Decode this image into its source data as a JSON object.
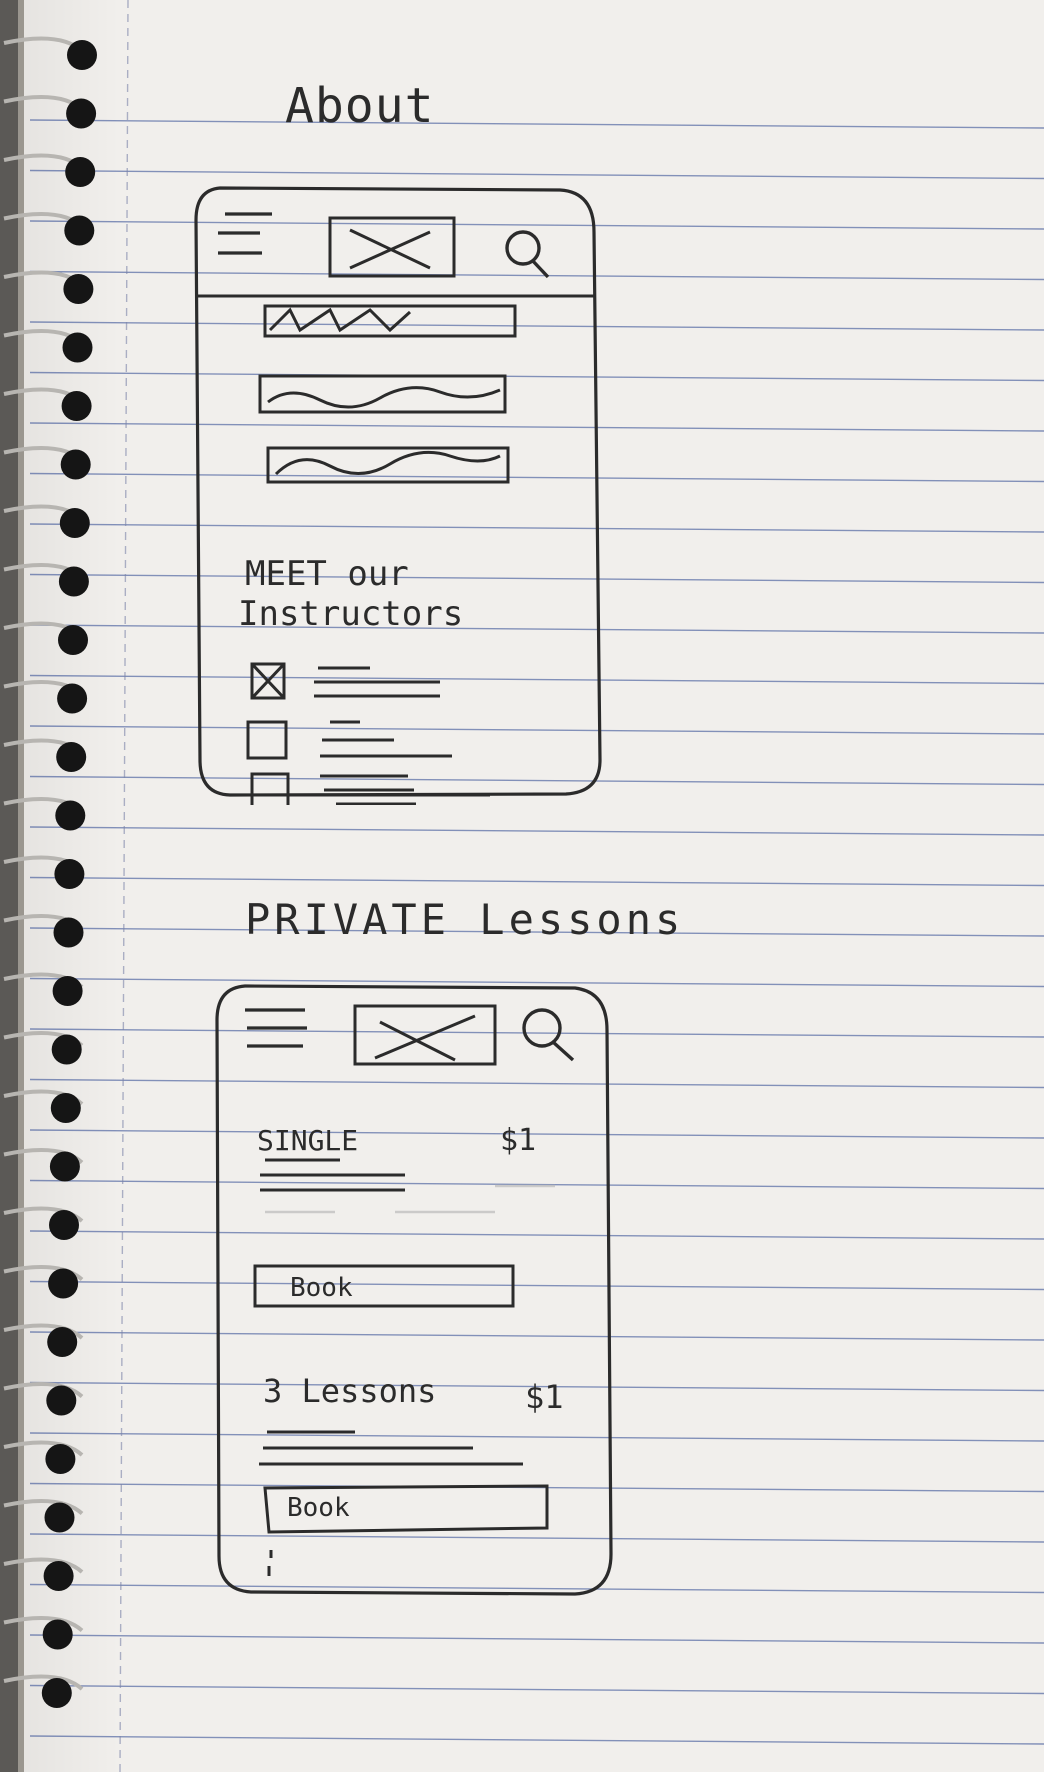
{
  "notebook": {
    "paper_color": "#f1efec",
    "rule_color": "#1f3a8a",
    "ink_color": "#2b2b2b"
  },
  "about": {
    "heading": "About",
    "section_title_line1": "MEET our",
    "section_title_line2": "Instructors",
    "header_icons": [
      "hamburger-menu-icon",
      "logo-placeholder-icon",
      "search-icon"
    ],
    "instructor_rows": 3
  },
  "private_lessons": {
    "heading": "PRIVATE Lessons",
    "header_icons": [
      "hamburger-menu-icon",
      "logo-placeholder-icon",
      "search-icon"
    ],
    "cards": [
      {
        "title": "SINGLE",
        "price": "$1",
        "button": "Book"
      },
      {
        "title": "3 Lessons",
        "price": "$1",
        "button": "Book"
      }
    ]
  }
}
